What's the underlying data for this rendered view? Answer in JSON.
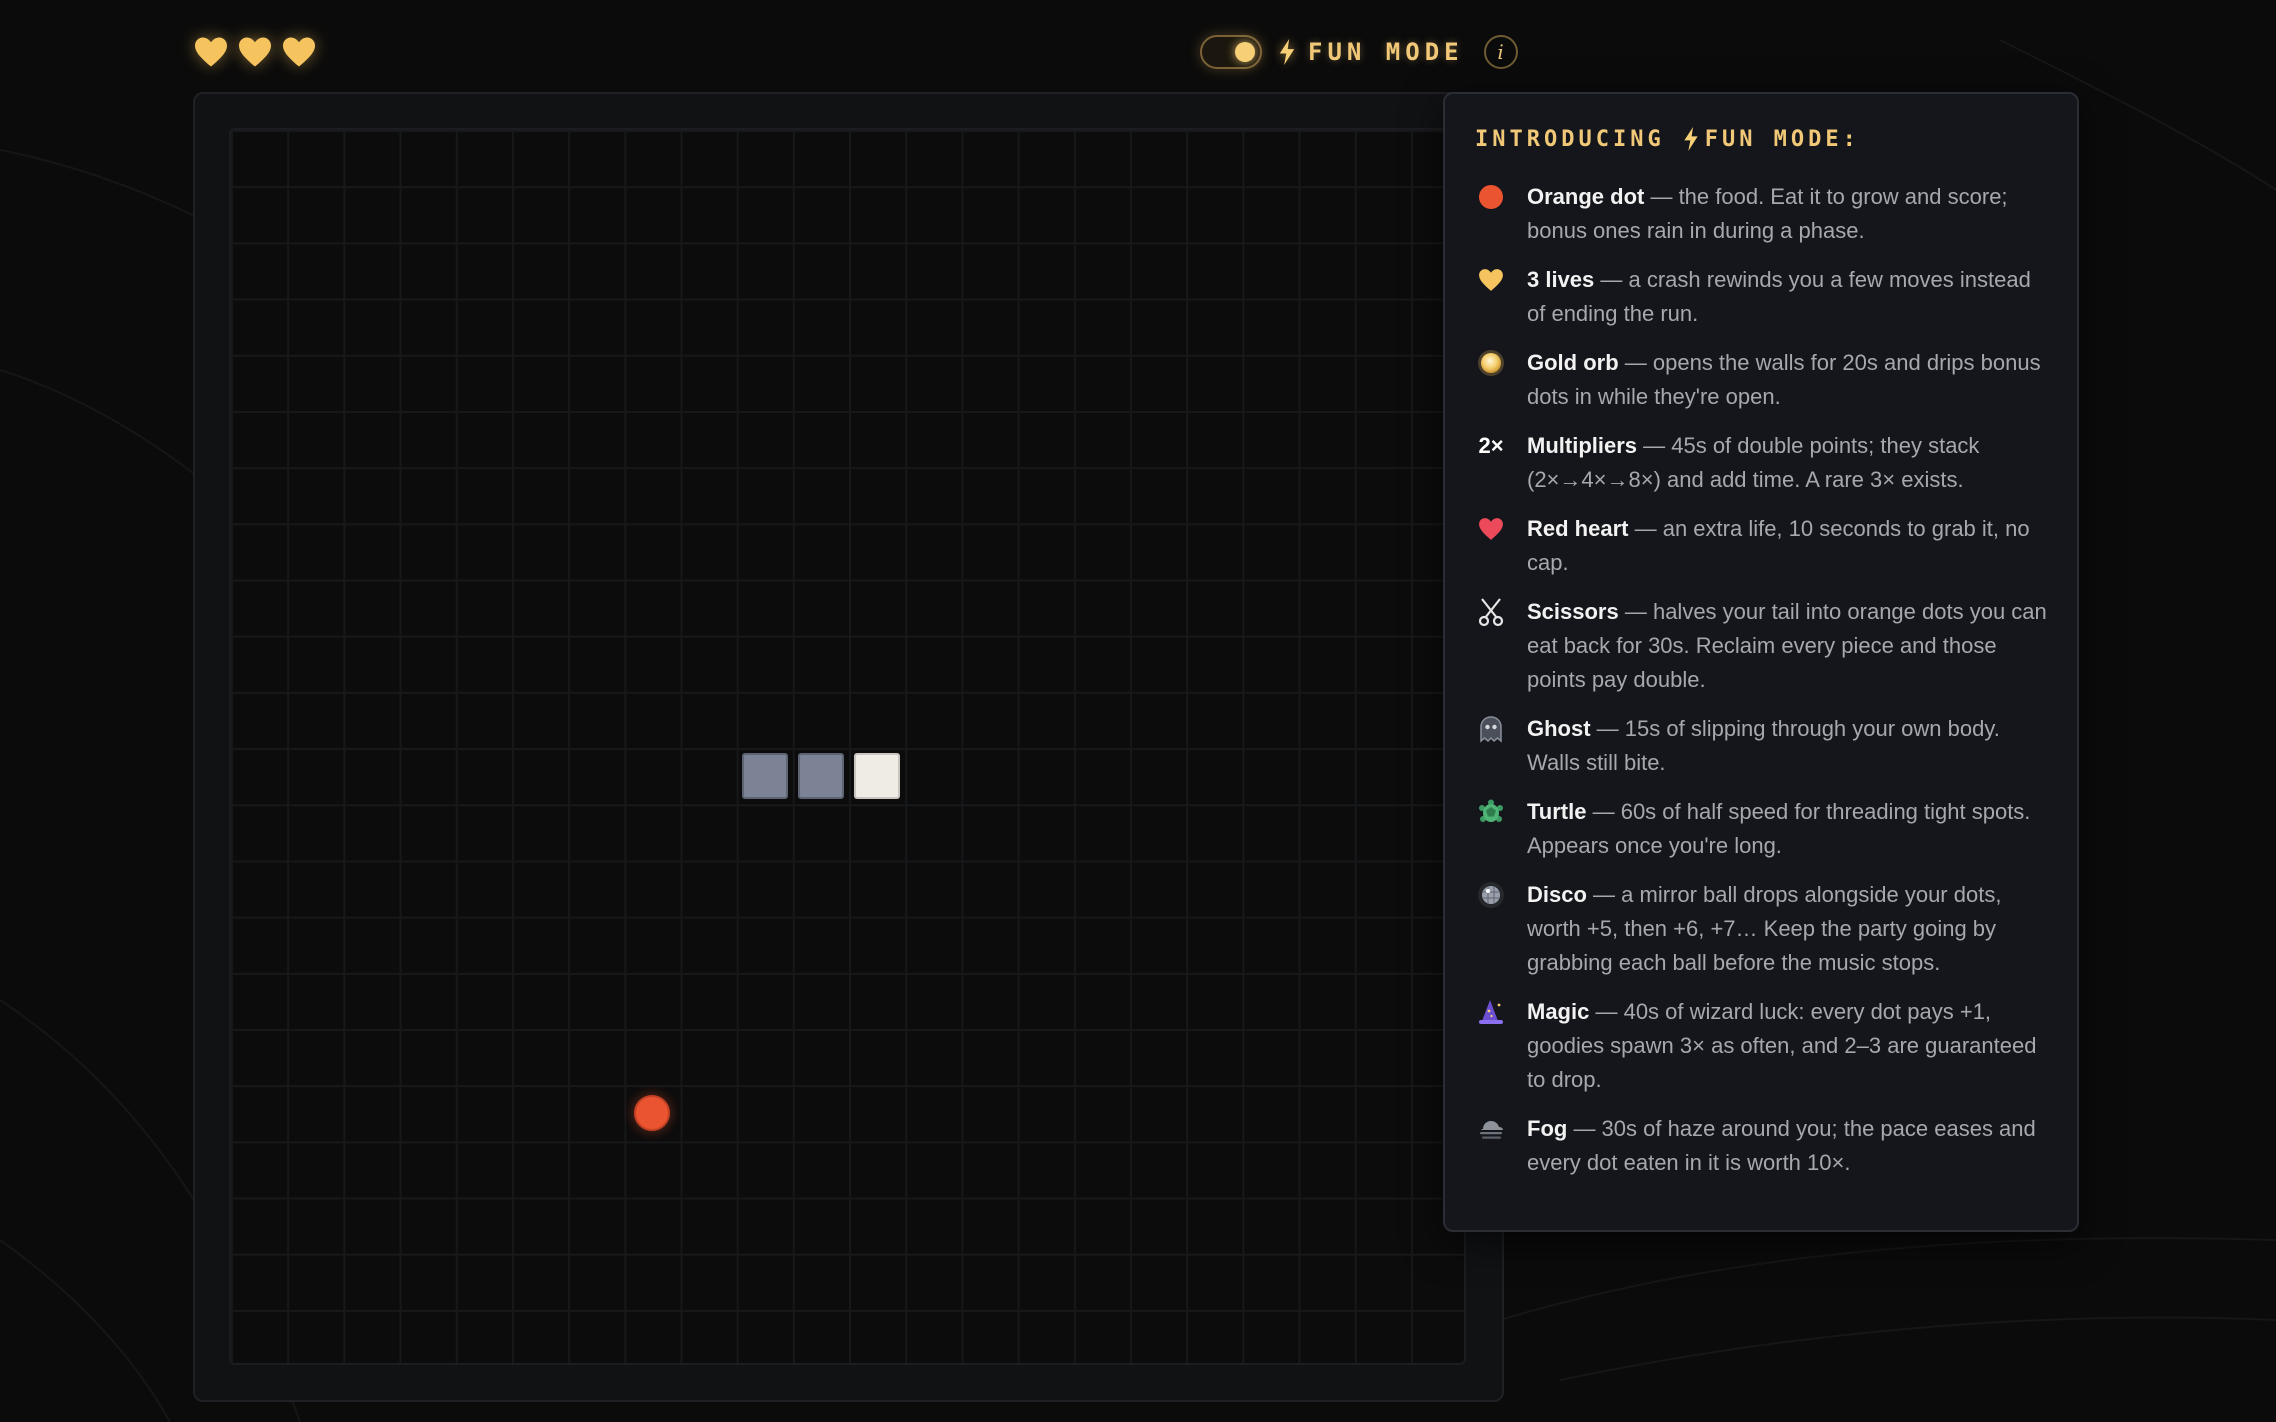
{
  "header": {
    "lives": [
      {
        "icon": "gold-heart-icon"
      },
      {
        "icon": "gold-heart-icon"
      },
      {
        "icon": "gold-heart-icon"
      }
    ],
    "fun_mode": {
      "toggle_on": true,
      "label": "FUN MODE",
      "info_label": "i"
    }
  },
  "board": {
    "snake": [
      {
        "col": 9,
        "row": 11,
        "part": "body"
      },
      {
        "col": 10,
        "row": 11,
        "part": "body"
      },
      {
        "col": 11,
        "row": 11,
        "part": "head"
      }
    ],
    "food": {
      "col": 7,
      "row": 17
    }
  },
  "info_panel": {
    "title_prefix": "INTRODUCING",
    "title_suffix": "FUN MODE:",
    "rules": [
      {
        "icon": "orange-dot-icon",
        "name": "Orange dot",
        "desc": " — the food. Eat it to grow and score; bonus ones rain in during a phase."
      },
      {
        "icon": "gold-heart-icon",
        "name": "3 lives",
        "desc": " — a crash rewinds you a few moves instead of ending the run."
      },
      {
        "icon": "gold-orb-icon",
        "name": "Gold orb",
        "desc": " — opens the walls for 20s and drips bonus dots in while they're open."
      },
      {
        "icon": "2x-icon",
        "icon_text": "2×",
        "name": "Multipliers",
        "desc": " — 45s of double points; they stack (2×→4×→8×) and add time. A rare 3× exists."
      },
      {
        "icon": "red-heart-icon",
        "name": "Red heart",
        "desc": " — an extra life, 10 seconds to grab it, no cap."
      },
      {
        "icon": "scissors-icon",
        "name": "Scissors",
        "desc": " — halves your tail into orange dots you can eat back for 30s. Reclaim every piece and those points pay double."
      },
      {
        "icon": "ghost-icon",
        "name": "Ghost",
        "desc": " — 15s of slipping through your own body. Walls still bite."
      },
      {
        "icon": "turtle-icon",
        "name": "Turtle",
        "desc": " — 60s of half speed for threading tight spots. Appears once you're long."
      },
      {
        "icon": "disco-ball-icon",
        "name": "Disco",
        "desc": " — a mirror ball drops alongside your dots, worth +5, then +6, +7… Keep the party going by grabbing each ball before the music stops."
      },
      {
        "icon": "wizard-hat-icon",
        "name": "Magic",
        "desc": " — 40s of wizard luck: every dot pays +1, goodies spawn 3× as often, and 2–3 are guaranteed to drop."
      },
      {
        "icon": "fog-cloud-icon",
        "name": "Fog",
        "desc": " — 30s of haze around you; the pace eases and every dot eaten in it is worth 10×."
      }
    ]
  },
  "colors": {
    "accent_gold": "#f1c877",
    "food_orange": "#ea5430",
    "snake_body": "#7b8394",
    "snake_head": "#efece6",
    "panel_bg": "#14161b",
    "page_bg": "#0b0b0b"
  }
}
